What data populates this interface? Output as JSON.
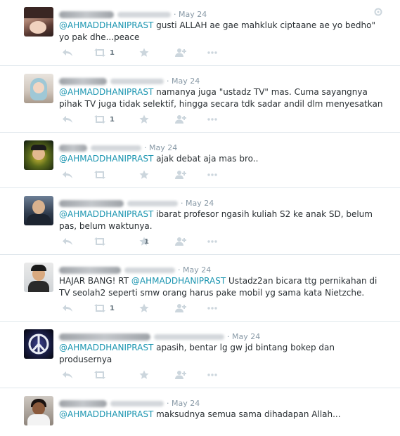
{
  "tweets": [
    {
      "time": "May 24",
      "mention": "@AHMADDHANIPRAST",
      "text": " gusti ALLAH ae gae mahkluk ciptaane ae yo bedho\" yo pak dhe...peace",
      "retweets": "1",
      "favorites": ""
    },
    {
      "time": "May 24",
      "mention": "@AHMADDHANIPRAST",
      "text": " namanya juga \"ustadz TV\" mas. Cuma sayangnya pihak TV juga tidak selektif, hingga secara tdk sadar andil dlm menyesatkan",
      "retweets": "1",
      "favorites": ""
    },
    {
      "time": "May 24",
      "mention": "@AHMADDHANIPRAST",
      "text": " ajak debat aja mas bro..",
      "retweets": "",
      "favorites": ""
    },
    {
      "time": "May 24",
      "mention": "@AHMADDHANIPRAST",
      "text": " ibarat profesor ngasih kuliah S2 ke anak SD, belum pas, belum waktunya.",
      "retweets": "",
      "favorites": "1"
    },
    {
      "time": "May 24",
      "prefix": "HAJAR BANG! RT ",
      "mention": "@AHMADDHANIPRAST",
      "text": " Ustadz2an bicara ttg pernikahan di TV seolah2 seperti smw orang harus pake mobil yg sama kata Nietzche.",
      "retweets": "1",
      "favorites": ""
    },
    {
      "time": "May 24",
      "mention": "@AHMADDHANIPRAST",
      "text": " apasih, bentar lg gw jd bintang bokep dan produsernya",
      "retweets": "",
      "favorites": ""
    },
    {
      "time": "May 24",
      "mention": "@AHMADDHANIPRAST",
      "text": " maksudnya semua sama dihadapan Allah...",
      "retweets": "",
      "favorites": ""
    }
  ],
  "icons": {
    "reply": "reply-icon",
    "retweet": "retweet-icon",
    "favorite": "star-icon",
    "follow": "follow-user-icon",
    "more": "more-dots-icon",
    "collapse": "gear-icon"
  },
  "colors": {
    "mention": "#1b95b0",
    "icon": "#ccd6dd",
    "time": "#8899a6",
    "text": "#292f33",
    "divider": "#e1e8ed"
  }
}
